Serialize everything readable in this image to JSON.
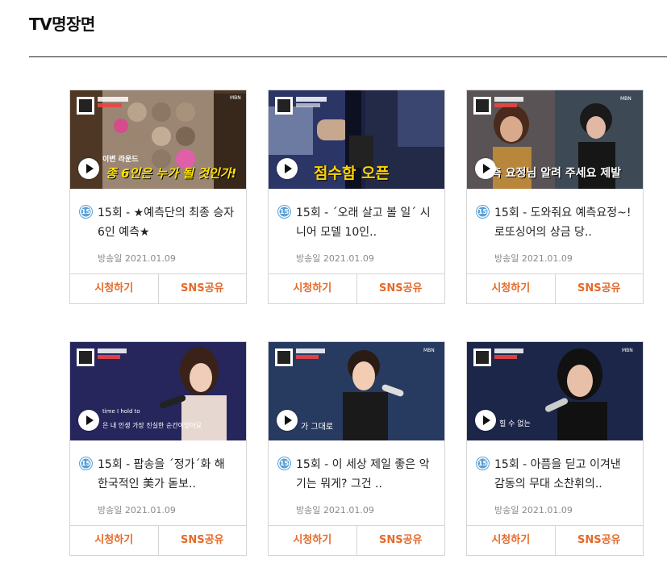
{
  "section": {
    "title": "TV명장면"
  },
  "rating_badge": "15",
  "actions": {
    "watch": "시청하기",
    "share": "SNS공유"
  },
  "colors": {
    "accent": "#e46a2a",
    "rating_blue": "#5aa0d8"
  },
  "clips": [
    {
      "title": "15회 - ★예측단의 최종 승자 6인 예측★",
      "date": "방송일 2021.01.09",
      "thumb_caption": "종 6인은 누가 될 것인가!",
      "thumb_top": "이변 라운드"
    },
    {
      "title": "15회 - ´오래 살고 볼 일´ 시니어 모델 10인..",
      "date": "방송일 2021.01.09",
      "thumb_caption": "점수함 오픈"
    },
    {
      "title": "15회 - 도와줘요 예측요정~! 로또싱어의 상금 당..",
      "date": "방송일 2021.01.09",
      "thumb_caption": "측 요정님 알려 주세요 제발"
    },
    {
      "title": "15회 - 팝송을 ´정가´화 해 한국적인 美가 돋보..",
      "date": "방송일 2021.01.09",
      "thumb_caption": "은 내 인생 가장 진실한 순간이었어요"
    },
    {
      "title": "15회 - 이 세상 제일 좋은 악기는 뭐게? 그건 ..",
      "date": "방송일 2021.01.09",
      "thumb_caption": "가 그대로"
    },
    {
      "title": "15회 - 아픔을 딛고 이겨낸 감동의 무대 소찬휘의..",
      "date": "방송일 2021.01.09",
      "thumb_caption": "힐 수 없는"
    }
  ]
}
